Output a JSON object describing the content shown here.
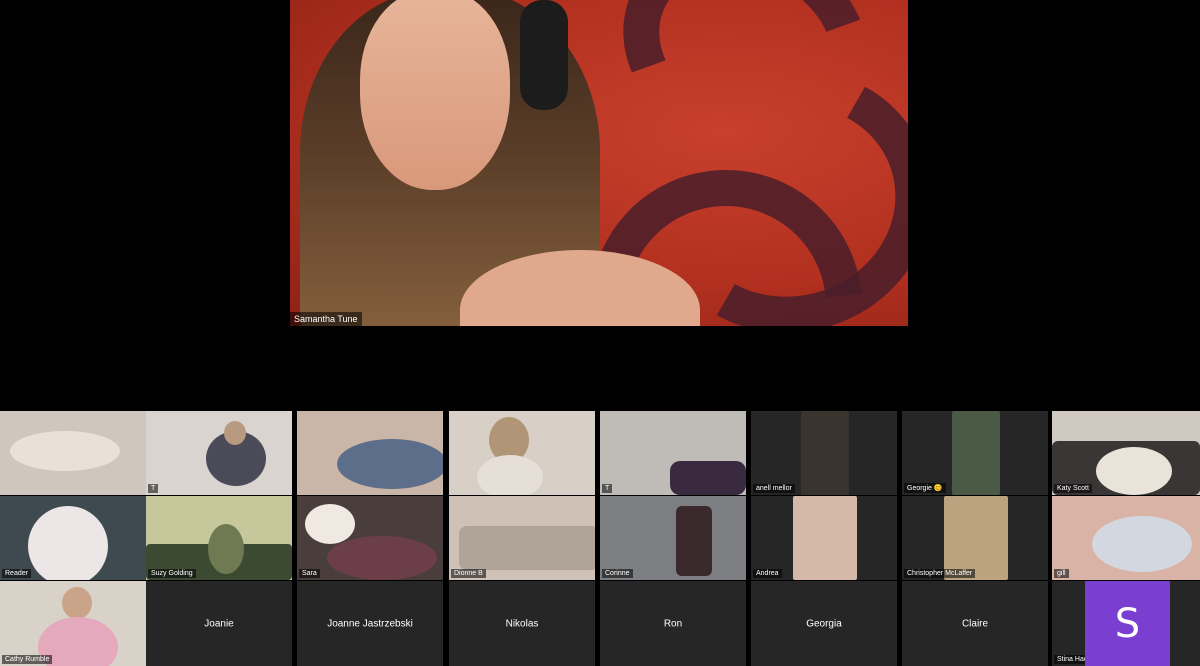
{
  "speaker": {
    "name": "Samantha Tune"
  },
  "row1": [
    {
      "name": ""
    },
    {
      "name": "T"
    },
    {
      "name": ""
    },
    {
      "name": ""
    },
    {
      "name": "T"
    },
    {
      "name": "anell mellor"
    },
    {
      "name": "Georgie 😊"
    },
    {
      "name": "Katy Scott"
    }
  ],
  "row2": [
    {
      "name": "Reader"
    },
    {
      "name": "Suzy Golding"
    },
    {
      "name": "Sara"
    },
    {
      "name": "Dionne B"
    },
    {
      "name": "Corinne"
    },
    {
      "name": "Andrea"
    },
    {
      "name": "Christopher McLaffer"
    },
    {
      "name": "gill"
    }
  ],
  "row3": [
    {
      "name": "Cathy Rumble"
    },
    {
      "name": "Joanie"
    },
    {
      "name": "Joanne Jastrzebski"
    },
    {
      "name": "Nikolas"
    },
    {
      "name": "Ron"
    },
    {
      "name": "Georgia"
    },
    {
      "name": "Claire"
    },
    {
      "name": "Stina Hadzic"
    }
  ],
  "avatar": {
    "letter": "S",
    "color": "#7a3fd1"
  }
}
